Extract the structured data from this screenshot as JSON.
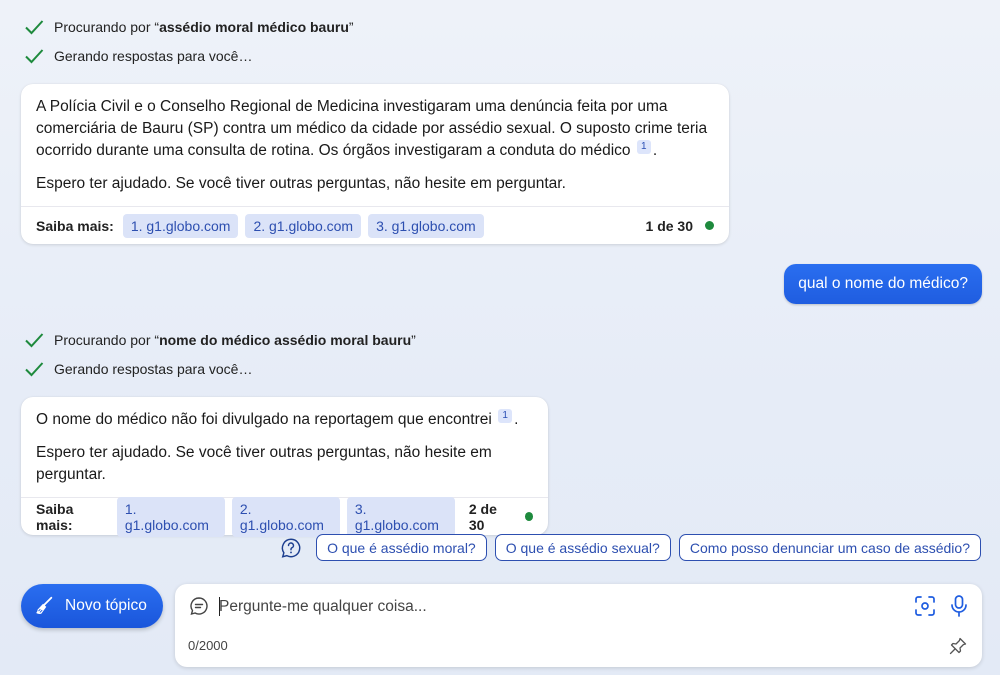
{
  "colors": {
    "accent": "#1f5de0",
    "check_green": "#1e8a3d",
    "chip_bg": "#dbe3f8",
    "chip_text": "#2d4fb0"
  },
  "turn1": {
    "status": [
      {
        "icon": "check-icon",
        "prefix": "Procurando por “",
        "query": "assédio moral médico bauru",
        "suffix": "”"
      },
      {
        "icon": "check-icon",
        "text": "Gerando respostas para você…"
      }
    ],
    "answer": {
      "para1": "A Polícia Civil e o Conselho Regional de Medicina investigaram uma denúncia feita por uma comerciária de Bauru (SP) contra um médico da cidade por assédio sexual. O suposto crime teria ocorrido durante uma consulta de rotina. Os órgãos investigaram a conduta do médico",
      "cite": "1",
      "para1_end": ".",
      "para2": "Espero ter ajudado. Se você tiver outras perguntas, não hesite em perguntar."
    },
    "footer": {
      "saiba": "Saiba mais:",
      "sources": [
        "1. g1.globo.com",
        "2. g1.globo.com",
        "3. g1.globo.com"
      ],
      "count": "1 de 30"
    }
  },
  "user_message": "qual o nome do médico?",
  "turn2": {
    "status": [
      {
        "icon": "check-icon",
        "prefix": "Procurando por “",
        "query": "nome do médico assédio moral bauru",
        "suffix": "”"
      },
      {
        "icon": "check-icon",
        "text": "Gerando respostas para você…"
      }
    ],
    "answer": {
      "para1": "O nome do médico não foi divulgado na reportagem que encontrei",
      "cite": "1",
      "para1_end": ".",
      "para2": "Espero ter ajudado. Se você tiver outras perguntas, não hesite em perguntar."
    },
    "footer": {
      "saiba": "Saiba mais:",
      "sources": [
        "1. g1.globo.com",
        "2. g1.globo.com",
        "3. g1.globo.com"
      ],
      "count": "2 de 30"
    }
  },
  "suggestions": {
    "icon": "question-bubble-icon",
    "items": [
      "O que é assédio moral?",
      "O que é assédio sexual?",
      "Como posso denunciar um caso de assédio?"
    ]
  },
  "composer": {
    "new_topic_label": "Novo tópico",
    "placeholder": "Pergunte-me qualquer coisa...",
    "counter": "0/2000"
  }
}
